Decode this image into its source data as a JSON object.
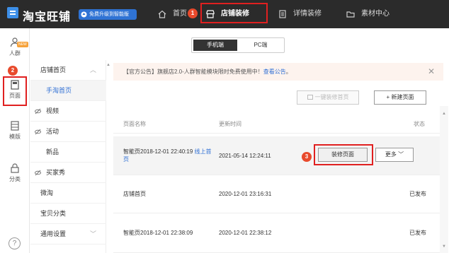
{
  "topbar": {
    "brand": "淘宝旺铺",
    "upgrade_label": "免费升级到智能版",
    "nav": [
      {
        "label": "首页",
        "icon": "home-icon"
      },
      {
        "label": "店铺装修",
        "icon": "shop-icon"
      },
      {
        "label": "详情装修",
        "icon": "detail-doc-icon"
      },
      {
        "label": "素材中心",
        "icon": "folder-icon"
      }
    ]
  },
  "annotations": {
    "b1": "1",
    "b2": "2",
    "b3": "3"
  },
  "leftbar": {
    "items": [
      {
        "label": "人群",
        "icon": "user-icon",
        "tag": "NEW"
      },
      {
        "label": "页面",
        "icon": "page-icon"
      },
      {
        "label": "模版",
        "icon": "template-icon"
      },
      {
        "label": "分类",
        "icon": "lock-icon"
      }
    ],
    "help": "?"
  },
  "subnav": {
    "items": [
      {
        "label": "店铺首页",
        "caret": "︿"
      },
      {
        "label": "手淘首页"
      },
      {
        "label": "视频"
      },
      {
        "label": "活动"
      },
      {
        "label": "新品"
      },
      {
        "label": "买家秀"
      },
      {
        "label": "微淘"
      },
      {
        "label": "宝贝分类"
      },
      {
        "label": "通用设置",
        "caret": "﹀"
      }
    ]
  },
  "toggle": {
    "mobile": "手机端",
    "pc": "PC端"
  },
  "notice": {
    "prefix": "【官方公告】旗舰店2.0-人群智能模块限时免费使用中！",
    "link": "查看公告",
    "suffix": "。",
    "close": "✕"
  },
  "toolbar": {
    "one_click": "一键装修首页",
    "new_page": "+ 新建页面"
  },
  "table": {
    "headers": {
      "name": "页面名称",
      "time": "更新时间",
      "status": "状态"
    },
    "rows": [
      {
        "name": "智能页2018-12-01 22:40:19",
        "name_link": "线上首页",
        "time": "2021-05-14 12:24:11",
        "status": "",
        "decorate": "装修页面",
        "more": "更多"
      },
      {
        "name": "店铺首页",
        "time": "2020-12-01 23:16:31",
        "status": "已发布"
      },
      {
        "name": "智能页2018-12-01 22:38:09",
        "time": "2020-12-01 22:38:12",
        "status": "已发布"
      }
    ]
  },
  "colors": {
    "topbar_bg": "#2b2b2b",
    "accent_blue": "#2f6fd4",
    "annotation_red": "#e02020",
    "badge_red": "#e84a2c"
  }
}
